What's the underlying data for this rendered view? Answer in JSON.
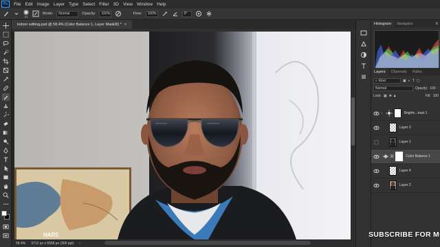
{
  "app": {
    "logo_text": "Ps"
  },
  "menu": [
    "File",
    "Edit",
    "Image",
    "Layer",
    "Type",
    "Select",
    "Filter",
    "3D",
    "View",
    "Window",
    "Help"
  ],
  "options_bar": {
    "brush_size": "21",
    "mode_label": "Mode:",
    "mode_value": "Normal",
    "opacity_label": "Opacity:",
    "opacity_value": "100%",
    "flow_label": "Flow:",
    "flow_value": "100%",
    "angle_value": "0°"
  },
  "document": {
    "tab_title": "indoor editing.psd @ 58.4% (Color Balance 1, Layer Mask/8) *",
    "zoom": "58.4%",
    "doc_info": "3712 px x 5568 px (300 ppi)"
  },
  "canvas_text": {
    "map_word": "HARE"
  },
  "panels": {
    "histogram_tabs": [
      "Histogram",
      "Navigator"
    ],
    "layers_tabs": [
      "Layers",
      "Channels",
      "Paths"
    ],
    "kind_label": "Kind",
    "blend_mode": "Normal",
    "opacity_label": "Opacity:",
    "opacity_value": "100",
    "lock_label": "Lock:",
    "fill_label": "Fill:",
    "fill_value": "100"
  },
  "layers": [
    {
      "name": "Brightn...trast 1",
      "type": "adjustment"
    },
    {
      "name": "Layer 3",
      "type": "pixel"
    },
    {
      "name": "Layer 1",
      "type": "pixel"
    },
    {
      "name": "Color Balance 1",
      "type": "adjustment",
      "selected": true
    },
    {
      "name": "Layer 4",
      "type": "pixel"
    },
    {
      "name": "Layer 2",
      "type": "pixel"
    }
  ],
  "watermark": "SUBSCRIBE FOR MO",
  "colors": {
    "menubar": "#2b2b2b",
    "panel": "#323232",
    "accent": "#31a8ff",
    "selected_layer": "#474747"
  }
}
